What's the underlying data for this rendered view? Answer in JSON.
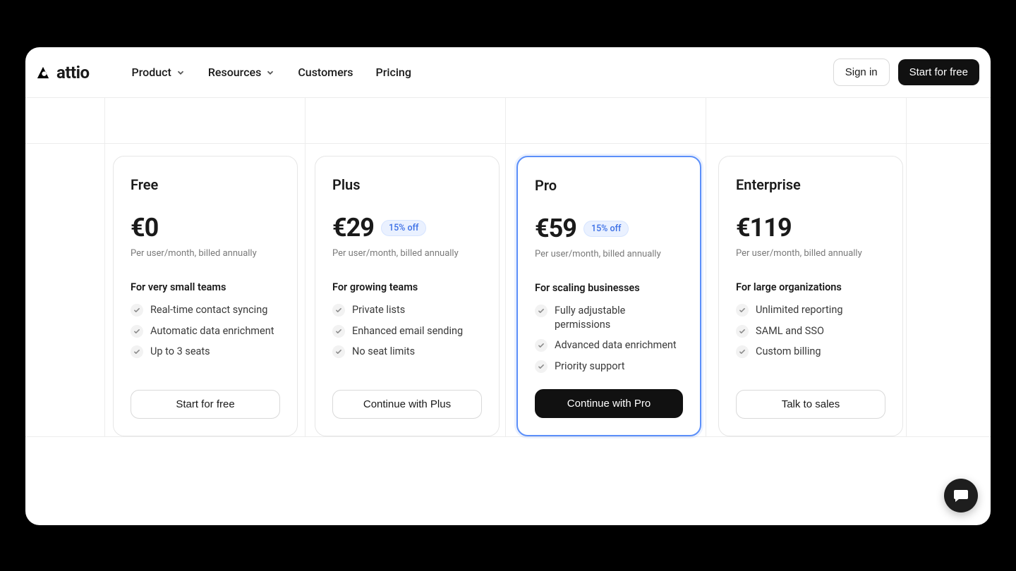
{
  "brand": {
    "name": "attio"
  },
  "nav": {
    "product": "Product",
    "resources": "Resources",
    "customers": "Customers",
    "pricing": "Pricing"
  },
  "header": {
    "signin": "Sign in",
    "start": "Start for free"
  },
  "billing_note": "Per user/month, billed annually",
  "plans": [
    {
      "name": "Free",
      "price": "€0",
      "discount": null,
      "tagline": "For very small teams",
      "features": [
        "Real-time contact syncing",
        "Automatic data enrichment",
        "Up to 3 seats"
      ],
      "cta": "Start for free",
      "cta_style": "outline",
      "highlight": false
    },
    {
      "name": "Plus",
      "price": "€29",
      "discount": "15% off",
      "tagline": "For growing teams",
      "features": [
        "Private lists",
        "Enhanced email sending",
        "No seat limits"
      ],
      "cta": "Continue with Plus",
      "cta_style": "outline",
      "highlight": false
    },
    {
      "name": "Pro",
      "price": "€59",
      "discount": "15% off",
      "tagline": "For scaling businesses",
      "features": [
        "Fully adjustable permissions",
        "Advanced data enrichment",
        "Priority support"
      ],
      "cta": "Continue with Pro",
      "cta_style": "dark",
      "highlight": true
    },
    {
      "name": "Enterprise",
      "price": "€119",
      "discount": null,
      "tagline": "For large organizations",
      "features": [
        "Unlimited reporting",
        "SAML and SSO",
        "Custom billing"
      ],
      "cta": "Talk to sales",
      "cta_style": "outline",
      "highlight": false
    }
  ]
}
